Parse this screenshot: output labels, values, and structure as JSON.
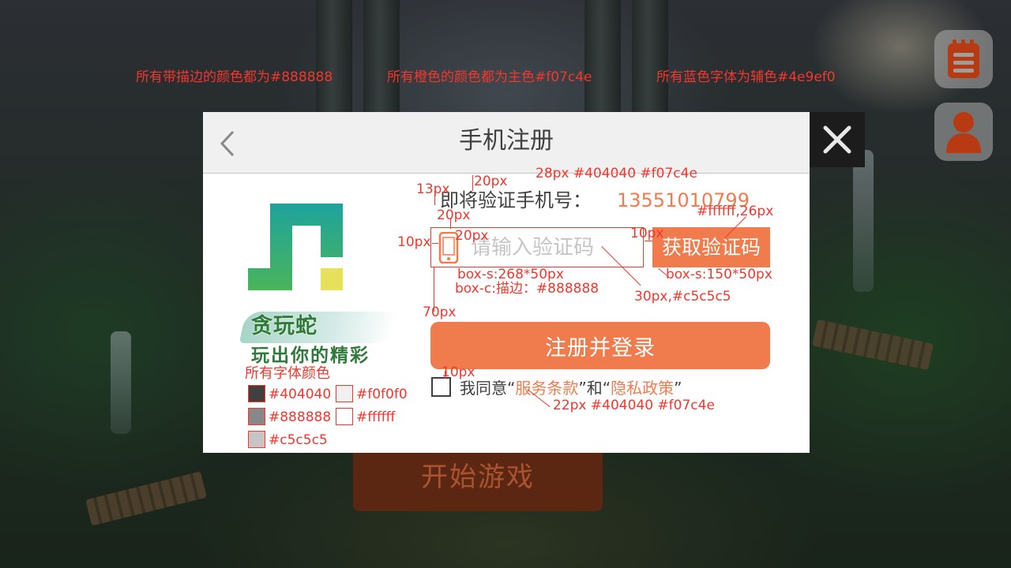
{
  "annotations": {
    "top_note_1": "所有带描边的颜色都为#888888",
    "top_note_2": "所有橙色的颜色都为主色#f07c4e",
    "top_note_3": "所有蓝色字体为辅色#4e9ef0",
    "label_title_spec": "28px #404040 #f07c4e",
    "label_13px": "13px",
    "label_20px_top": "20px",
    "label_20px_left": "20px",
    "label_20px_icon": "20px",
    "label_10px_left": "10px",
    "label_10px_right": "10px",
    "label_white_26": "#ffffff,26px",
    "label_box_input_size": "box-s:268*50px",
    "label_box_input_color": "box-c:描边：#888888",
    "label_30px": "30px,#c5c5c5",
    "label_box_btn_size": "box-s:150*50px",
    "label_70px": "70px",
    "label_10px_bottom": "10px",
    "label_22px": "22px #404040 #f07c4e",
    "font_colors_title": "所有字体颜色",
    "font_colors": [
      "#404040",
      "#f0f0f0",
      "#888888",
      "#ffffff",
      "#c5c5c5"
    ]
  },
  "background": {
    "start_button_label": "开始游戏"
  },
  "side_buttons": {
    "notes_icon": "notepad-icon",
    "profile_icon": "user-icon"
  },
  "dialog": {
    "title": "手机注册",
    "back_icon": "chevron-left-icon",
    "close_icon": "close-icon",
    "logo": {
      "name_line": "贪玩蛇",
      "slogan_line": "玩出你的精彩"
    },
    "verify_label": "即将验证手机号：",
    "phone_number": "13551010799",
    "code_input": {
      "placeholder": "请输入验证码",
      "value": ""
    },
    "get_code_button": "获取验证码",
    "register_button": "注册并登录",
    "agreement": {
      "prefix": "我同意“",
      "terms": "服务条款",
      "middle": "”和“",
      "privacy": "隐私政策",
      "suffix": "”"
    }
  },
  "colors": {
    "primary": "#f07c4e",
    "secondary_blue": "#4e9ef0",
    "text_dark": "#404040",
    "border": "#888888",
    "placeholder": "#c5c5c5",
    "header_bg": "#f0f0f0",
    "annotation_red": "#f2372e"
  }
}
